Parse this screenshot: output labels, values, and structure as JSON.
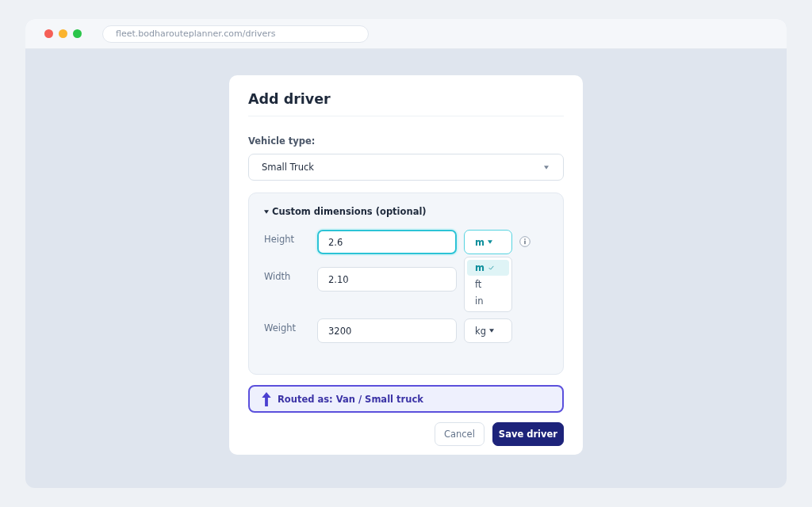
{
  "browser": {
    "url": "fleet.bodharouteplanner.com/drivers"
  },
  "dialog": {
    "title": "Add driver",
    "vehicle_type": {
      "label": "Vehicle type:",
      "value": "Small Truck"
    },
    "dimensions": {
      "title": "Custom dimensions (optional)",
      "expanded": true,
      "fields": [
        {
          "label": "Height",
          "value": "2.6",
          "focused": true,
          "info": true,
          "unit": {
            "value": "m",
            "open": true,
            "options": [
              {
                "label": "m",
                "selected": true
              },
              {
                "label": "ft",
                "selected": false
              },
              {
                "label": "in",
                "selected": false
              }
            ]
          }
        },
        {
          "label": "Width",
          "value": "2.10",
          "focused": false,
          "info": false
        },
        {
          "label": "Weight",
          "value": "3200",
          "focused": false,
          "info": false,
          "unit": {
            "value": "kg",
            "open": false
          }
        }
      ]
    },
    "routing": {
      "text": "Routed as: Van / Small truck"
    },
    "buttons": [
      {
        "label": "Cancel",
        "kind": "secondary"
      },
      {
        "label": "Save driver",
        "kind": "primary"
      }
    ]
  }
}
